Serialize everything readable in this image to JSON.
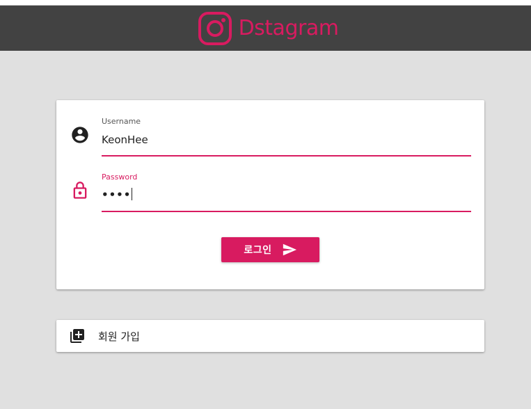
{
  "app": {
    "title": "Dstagram",
    "logo_icon": "instagram-logo-icon",
    "brand_color": "#d81b60",
    "appbar_color": "#424242",
    "background_color": "#e0e0e0"
  },
  "login_form": {
    "username": {
      "label": "Username",
      "value": "KeonHee",
      "icon": "account-circle-icon"
    },
    "password": {
      "label": "Password",
      "masked_value": "••••",
      "icon": "lock-icon",
      "focused": true
    },
    "submit": {
      "label": "로그인",
      "icon": "send-icon"
    }
  },
  "signup": {
    "label": "회원 가입",
    "icon": "library-add-icon"
  }
}
